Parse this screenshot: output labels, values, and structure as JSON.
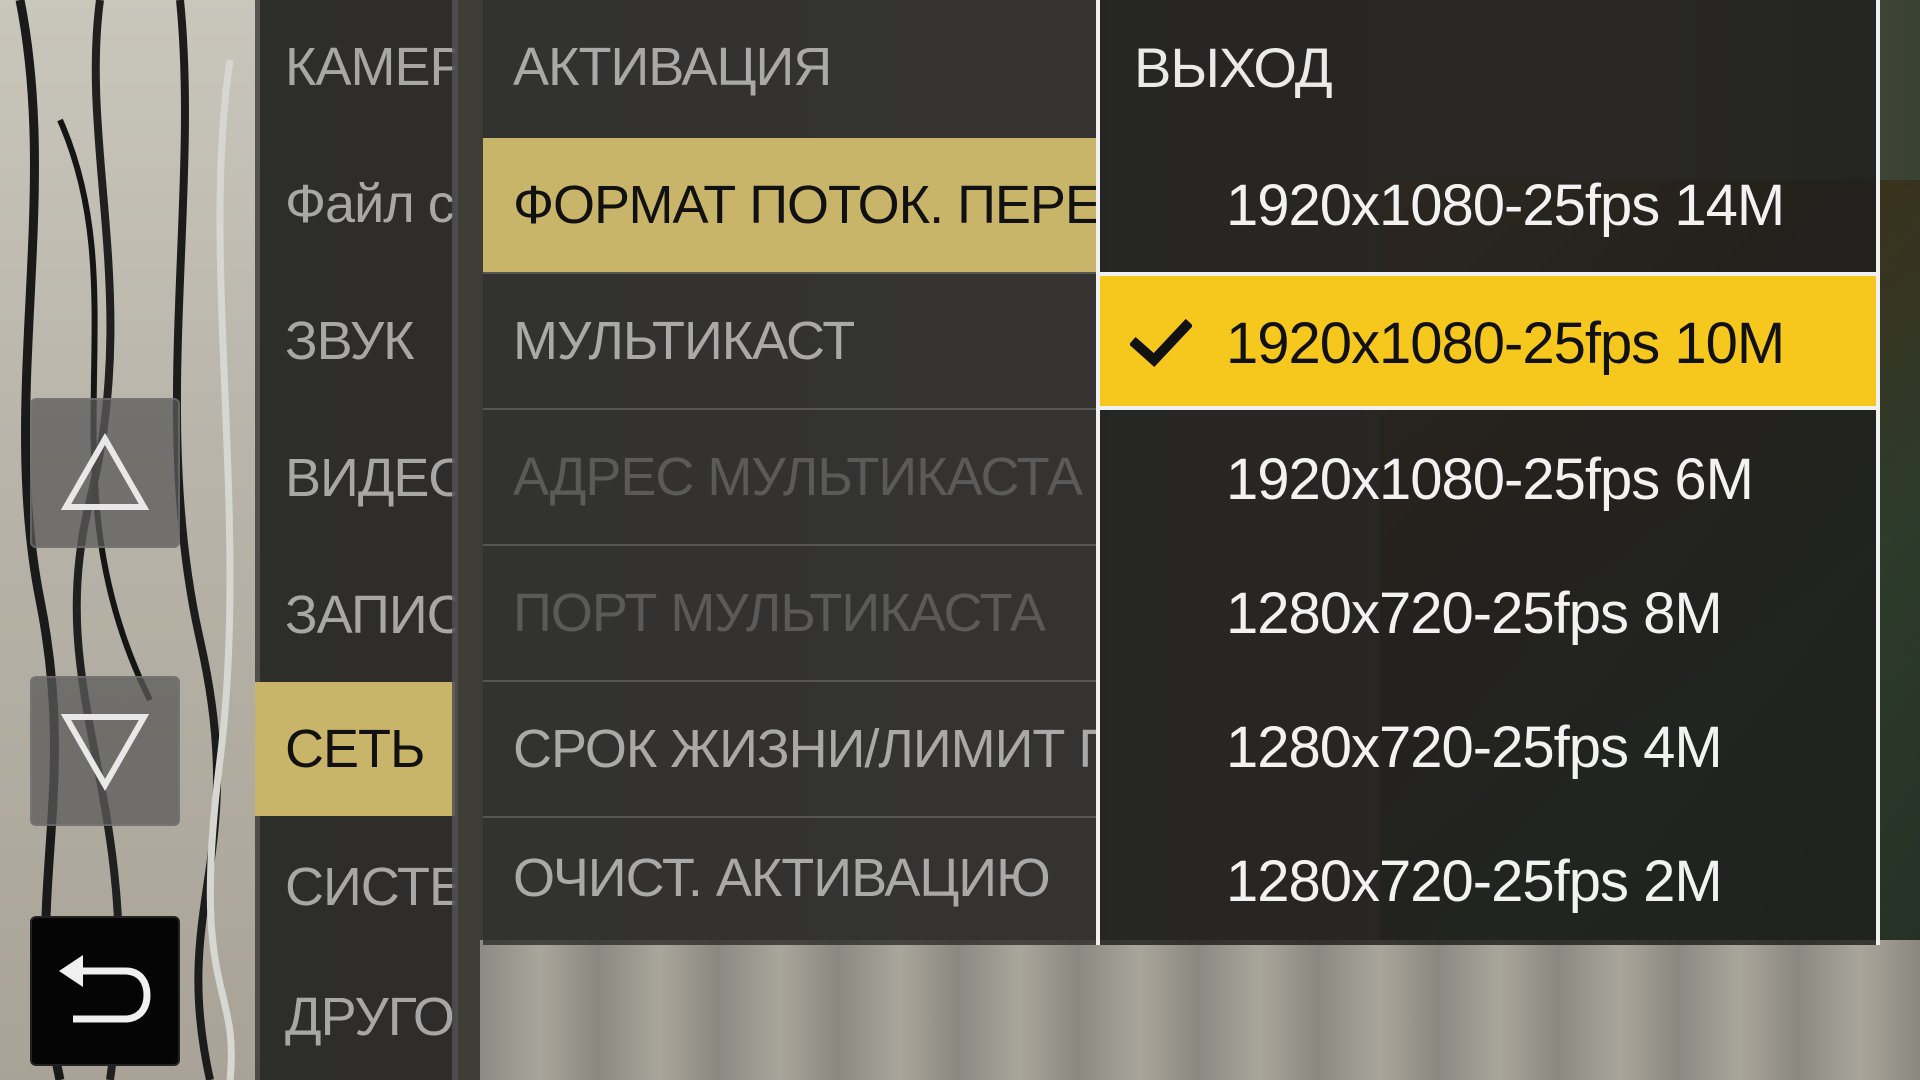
{
  "categories": [
    {
      "label": "КАМЕРА",
      "selected": false
    },
    {
      "label": "Файл сцены",
      "selected": false
    },
    {
      "label": "ЗВУК",
      "selected": false
    },
    {
      "label": "ВИДЕОВЫХОД",
      "selected": false
    },
    {
      "label": "ЗАПИСЬ",
      "selected": false
    },
    {
      "label": "СЕТЬ",
      "selected": true
    },
    {
      "label": "СИСТЕМА",
      "selected": false
    },
    {
      "label": "ДРУГОЕ",
      "selected": false
    }
  ],
  "settings": [
    {
      "label": "АКТИВАЦИЯ",
      "state": "normal"
    },
    {
      "label": "ФОРМАТ ПОТОК. ПЕРЕДАЧИ",
      "state": "selected"
    },
    {
      "label": "МУЛЬТИКАСТ",
      "state": "normal"
    },
    {
      "label": "АДРЕС МУЛЬТИКАСТА",
      "state": "disabled"
    },
    {
      "label": "ПОРТ МУЛЬТИКАСТА",
      "state": "disabled"
    },
    {
      "label": "СРОК ЖИЗНИ/ЛИМИТ ПЕРЕХОДОВ",
      "state": "normal"
    },
    {
      "label": "ОЧИСТ. АКТИВАЦИЮ",
      "state": "normal"
    }
  ],
  "options": {
    "exit_label": "ВЫХОД",
    "items": [
      {
        "label": "1920x1080-25fps 14M",
        "checked": false
      },
      {
        "label": "1920x1080-25fps 10M",
        "checked": true
      },
      {
        "label": "1920x1080-25fps 6M",
        "checked": false
      },
      {
        "label": "1280x720-25fps 8M",
        "checked": false
      },
      {
        "label": "1280x720-25fps 4M",
        "checked": false
      },
      {
        "label": "1280x720-25fps 2M",
        "checked": false
      }
    ]
  },
  "nav_buttons": {
    "up_icon": "up-triangle-icon",
    "down_icon": "down-triangle-icon",
    "back_icon": "back-return-icon"
  },
  "colors": {
    "selection_yellow": "#f6c71d",
    "selection_khaki": "#c8b56a"
  }
}
